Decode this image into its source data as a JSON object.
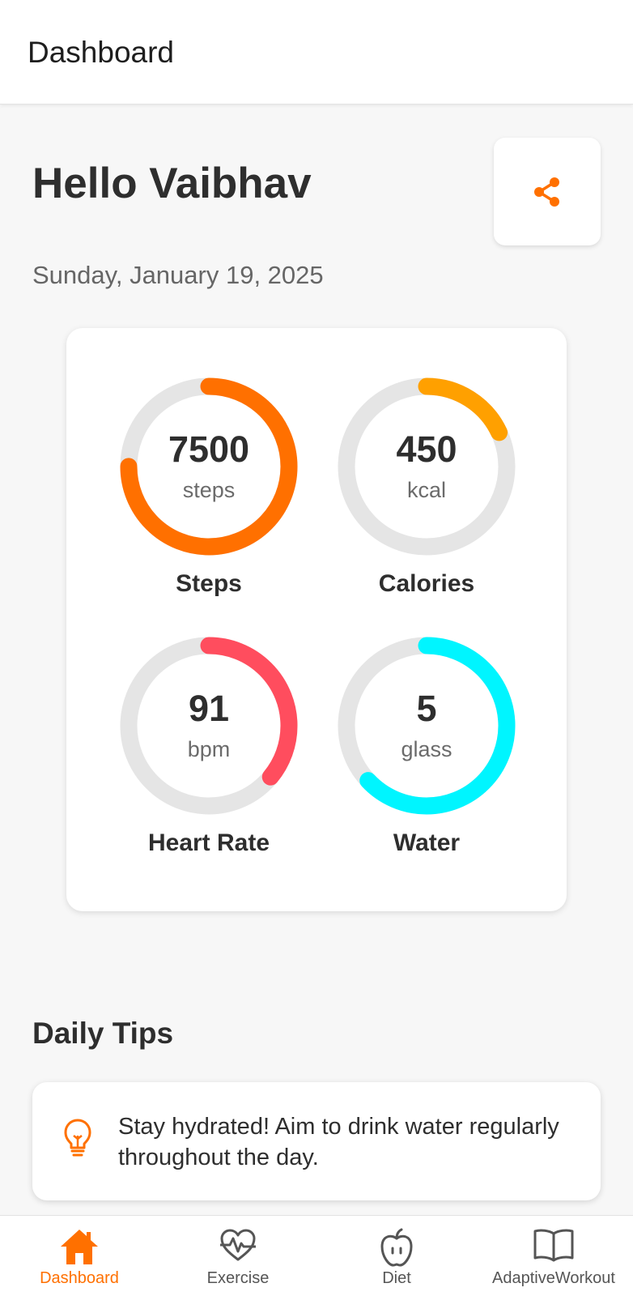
{
  "topbar": {
    "title": "Dashboard"
  },
  "greeting": "Hello Vaibhav",
  "date": "Sunday, January 19, 2025",
  "share": {
    "icon": "share-icon",
    "color": "#ff7000"
  },
  "stats": [
    {
      "id": "steps",
      "value": "7500",
      "unit": "steps",
      "label": "Steps",
      "progress": 0.75,
      "color": "#ff7000"
    },
    {
      "id": "calories",
      "value": "450",
      "unit": "kcal",
      "label": "Calories",
      "progress": 0.18,
      "color": "#ffa000"
    },
    {
      "id": "heart-rate",
      "value": "91",
      "unit": "bpm",
      "label": "Heart Rate",
      "progress": 0.36,
      "color": "#ff4d5e"
    },
    {
      "id": "water",
      "value": "5",
      "unit": "glass",
      "label": "Water",
      "progress": 0.63,
      "color": "#00f5ff"
    }
  ],
  "tips": {
    "heading": "Daily Tips",
    "items": [
      {
        "icon": "lightbulb-icon",
        "text": "Stay hydrated! Aim to drink water regularly throughout the day."
      }
    ]
  },
  "nav": {
    "items": [
      {
        "label": "Dashboard",
        "icon": "home-icon",
        "active": true
      },
      {
        "label": "Exercise",
        "icon": "heart-pulse-icon",
        "active": false
      },
      {
        "label": "Diet",
        "icon": "apple-icon",
        "active": false
      },
      {
        "label": "AdaptiveWorkout",
        "icon": "book-icon",
        "active": false
      }
    ]
  },
  "colors": {
    "accent": "#ff7000",
    "track": "#e5e5e5"
  }
}
